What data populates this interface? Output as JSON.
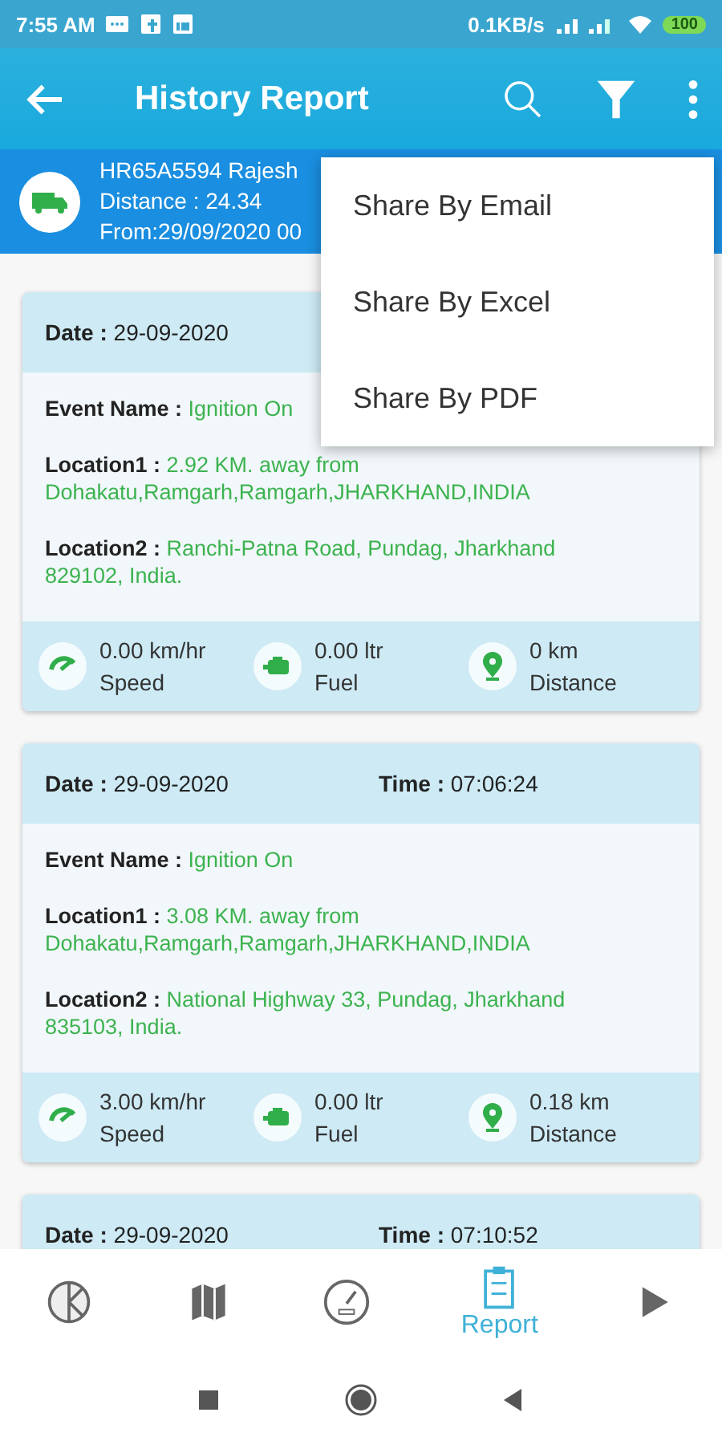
{
  "status_bar": {
    "time": "7:55 AM",
    "speed": "0.1KB/s",
    "battery": "100"
  },
  "app_bar": {
    "title": "History Report"
  },
  "vehicle": {
    "name": "HR65A5594 Rajesh",
    "distance": "Distance : 24.34",
    "from": "From:29/09/2020 00"
  },
  "menu": [
    "Share By Email",
    "Share By Excel",
    "Share By PDF"
  ],
  "cards": [
    {
      "date": {
        "label": "Date :",
        "value": "29-09-2020"
      },
      "fields": [
        {
          "label": "Event Name :",
          "value": "Ignition On"
        },
        {
          "label": "Location1 :",
          "value": "2.92 KM. away from Dohakatu,Ramgarh,Ramgarh,JHARKHAND,INDIA"
        },
        {
          "label": "Location2 :",
          "value": "Ranchi-Patna Road, Pundag, Jharkhand 829102, India."
        }
      ],
      "stats": [
        {
          "kind": "speed",
          "value": "0.00 km/hr",
          "label": "Speed"
        },
        {
          "kind": "fuel",
          "value": "0.00 ltr",
          "label": "Fuel"
        },
        {
          "kind": "distance",
          "value": "0 km",
          "label": "Distance"
        }
      ]
    },
    {
      "date": {
        "label": "Date :",
        "value": "29-09-2020"
      },
      "time": {
        "label": "Time :",
        "value": "07:06:24"
      },
      "fields": [
        {
          "label": "Event Name :",
          "value": "Ignition On"
        },
        {
          "label": "Location1 :",
          "value": "3.08 KM. away from Dohakatu,Ramgarh,Ramgarh,JHARKHAND,INDIA"
        },
        {
          "label": "Location2 :",
          "value": "National Highway 33, Pundag, Jharkhand 835103, India."
        }
      ],
      "stats": [
        {
          "kind": "speed",
          "value": "3.00 km/hr",
          "label": "Speed"
        },
        {
          "kind": "fuel",
          "value": "0.00 ltr",
          "label": "Fuel"
        },
        {
          "kind": "distance",
          "value": "0.18 km",
          "label": "Distance"
        }
      ]
    },
    {
      "date": {
        "label": "Date :",
        "value": "29-09-2020"
      },
      "time": {
        "label": "Time :",
        "value": "07:10:52"
      }
    }
  ],
  "bottom_nav": [
    {
      "kind": "dashboard",
      "selected": false
    },
    {
      "kind": "map",
      "selected": false
    },
    {
      "kind": "speedometer",
      "selected": false
    },
    {
      "kind": "report",
      "label": "Report",
      "selected": true
    },
    {
      "kind": "play",
      "selected": false
    }
  ]
}
